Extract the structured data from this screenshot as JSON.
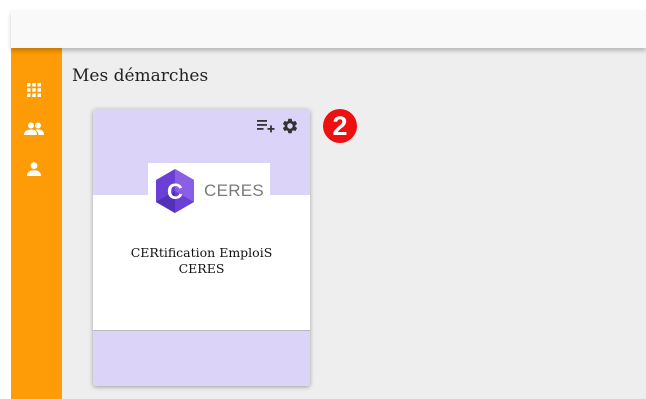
{
  "sidebar": {
    "background": "#fd9c06",
    "items": [
      {
        "icon": "apps-grid-icon"
      },
      {
        "icon": "group-icon"
      },
      {
        "icon": "person-icon"
      }
    ]
  },
  "main": {
    "heading": "Mes démarches"
  },
  "card": {
    "actions": [
      {
        "icon": "playlist-add-icon"
      },
      {
        "icon": "gear-icon"
      }
    ],
    "logo": {
      "letter": "C",
      "text": "CERES",
      "color": "#6a3fd6"
    },
    "title_line1": "CERtification EmploiS",
    "title_line2": "CERES",
    "accent": "#dcd3f8"
  },
  "annotation": {
    "badge": "2",
    "color": "#ee1111"
  }
}
